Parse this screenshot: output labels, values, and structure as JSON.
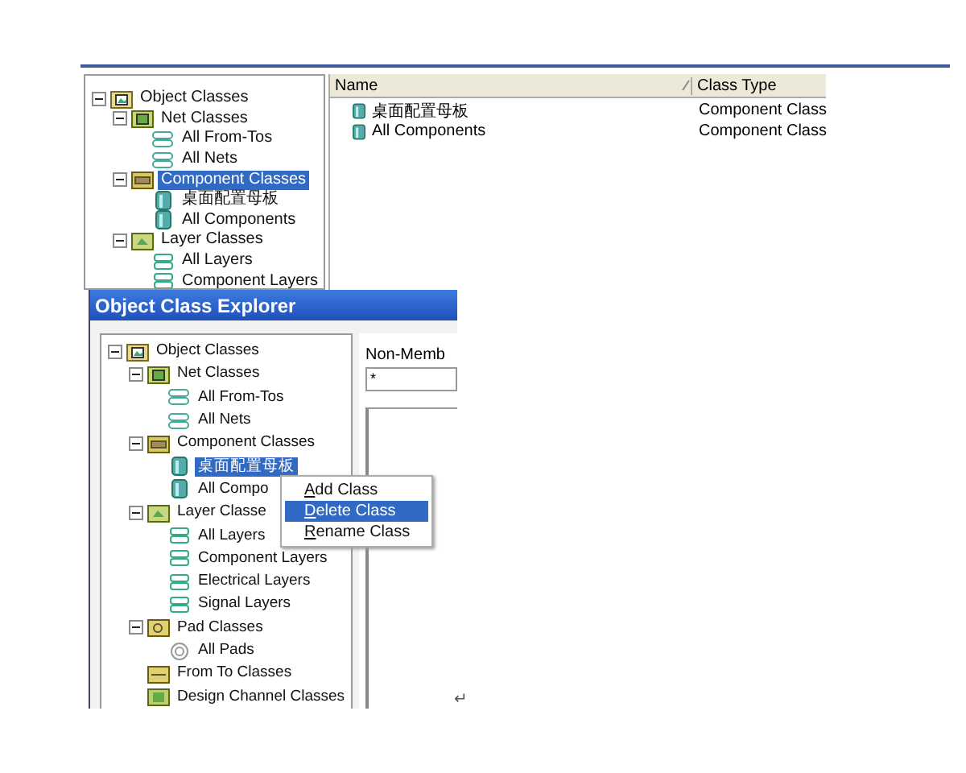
{
  "back_window": {
    "tree": [
      {
        "label": "Object Classes",
        "kind": "object",
        "expanded": true,
        "selected": false,
        "children": [
          {
            "label": "Net Classes",
            "kind": "net",
            "expanded": true,
            "selected": false,
            "children": [
              {
                "label": "All From-Tos",
                "kind": "netitem",
                "selected": false
              },
              {
                "label": "All Nets",
                "kind": "netitem",
                "selected": false
              }
            ]
          },
          {
            "label": "Component Classes",
            "kind": "component",
            "expanded": true,
            "selected": true,
            "children": [
              {
                "label": "桌面配置母板",
                "kind": "comp",
                "selected": false
              },
              {
                "label": "All Components",
                "kind": "comp",
                "selected": false
              }
            ]
          },
          {
            "label": "Layer Classes",
            "kind": "layer",
            "expanded": true,
            "selected": false,
            "children": [
              {
                "label": "All Layers",
                "kind": "layeritem",
                "selected": false
              },
              {
                "label": "Component Layers",
                "kind": "layeritem",
                "selected": false
              }
            ]
          }
        ]
      }
    ],
    "list": {
      "columns": [
        "Name",
        "Class Type"
      ],
      "rows": [
        {
          "name": "桌面配置母板",
          "class_type": "Component Class"
        },
        {
          "name": "All Components",
          "class_type": "Component Class"
        }
      ]
    }
  },
  "front_window": {
    "title": "Object Class Explorer",
    "tree": [
      {
        "label": "Object Classes",
        "kind": "object",
        "expanded": true,
        "selected": false,
        "children": [
          {
            "label": "Net Classes",
            "kind": "net",
            "expanded": true,
            "selected": false,
            "children": [
              {
                "label": "All From-Tos",
                "kind": "netitem",
                "selected": false
              },
              {
                "label": "All Nets",
                "kind": "netitem",
                "selected": false
              }
            ]
          },
          {
            "label": "Component Classes",
            "kind": "component",
            "expanded": true,
            "selected": false,
            "children": [
              {
                "label": "桌面配置母板",
                "kind": "comp",
                "selected": true
              },
              {
                "label": "All Compo",
                "kind": "comp",
                "selected": false
              }
            ]
          },
          {
            "label": "Layer Classe",
            "kind": "layer",
            "expanded": true,
            "selected": false,
            "children": [
              {
                "label": "All Layers",
                "kind": "layeritem",
                "selected": false
              },
              {
                "label": "Component Layers",
                "kind": "layeritem",
                "selected": false
              },
              {
                "label": "Electrical Layers",
                "kind": "layeritem",
                "selected": false
              },
              {
                "label": "Signal Layers",
                "kind": "layeritem",
                "selected": false
              }
            ]
          },
          {
            "label": "Pad Classes",
            "kind": "pad",
            "expanded": true,
            "selected": false,
            "children": [
              {
                "label": "All Pads",
                "kind": "paditem",
                "selected": false
              }
            ]
          },
          {
            "label": "From To Classes",
            "kind": "fromto",
            "selected": false
          },
          {
            "label": "Design Channel Classes",
            "kind": "channel",
            "selected": false
          }
        ]
      }
    ],
    "non_members_label": "Non-Memb",
    "non_members_field": {
      "value": "*"
    }
  },
  "context_menu": {
    "items": [
      {
        "label": "Add Class",
        "selected": false
      },
      {
        "label": "Delete Class",
        "selected": true
      },
      {
        "label": "Rename Class",
        "selected": false
      }
    ]
  },
  "paragraph_mark": "↵"
}
